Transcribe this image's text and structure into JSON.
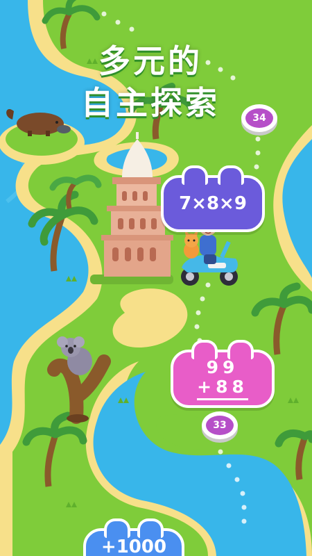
{
  "title": {
    "line1": "多元的",
    "line2": "自主探索"
  },
  "levels": [
    {
      "number": "34"
    },
    {
      "number": "33"
    }
  ],
  "bubbles": {
    "multiply": "7×8×9",
    "addition": {
      "top": "99",
      "bottom": "+88"
    },
    "bottom": "+1000"
  },
  "colors": {
    "water": "#38b6ea",
    "sand": "#f7e08a",
    "grass": "#7fcc3a",
    "bubble_purple": "#6b5bdb",
    "bubble_pink": "#e85dc8",
    "bubble_blue": "#4a8ff0",
    "level_node": "#b64fc8"
  },
  "characters": [
    "platypus",
    "koala",
    "boy-on-scooter",
    "orange-cat"
  ],
  "landmarks": [
    "tower-building",
    "palm-trees"
  ]
}
